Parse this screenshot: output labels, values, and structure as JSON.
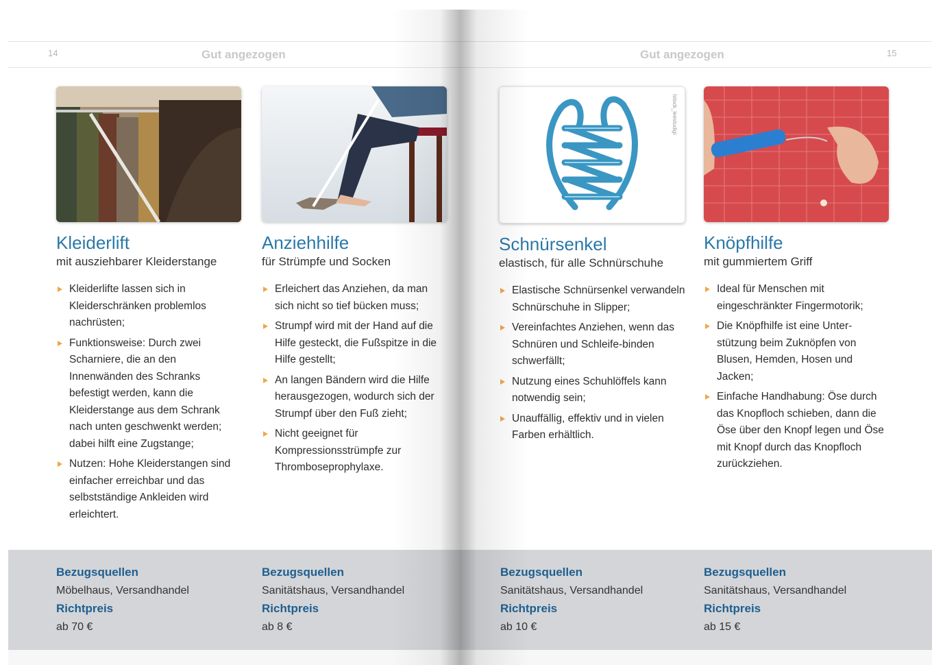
{
  "pages": {
    "left": {
      "number": "14",
      "running_head": "Gut angezogen"
    },
    "right": {
      "number": "15",
      "running_head": "Gut angezogen"
    }
  },
  "products": [
    {
      "title": "Kleiderlift",
      "subtitle": "mit ausziehbarer Kleiderstange",
      "bullets": [
        "Kleiderlifte lassen sich in Kleiderschränken problemlos nachrüsten;",
        "Funktionsweise: Durch zwei Scharniere, die an den Innenwänden des Schranks befestigt werden, kann die Kleiderstange aus dem Schrank nach unten geschwenkt werden; dabei hilft eine Zugstange;",
        "Nutzen: Hohe Kleiderstangen sind einfacher erreichbar und das selbstständige Ankleiden wird erleichtert."
      ],
      "sources_label": "Bezugsquellen",
      "sources": "Möbelhaus, Versandhandel",
      "price_label": "Richtpreis",
      "price": "ab 70 €"
    },
    {
      "title": "Anziehhilfe",
      "subtitle": "für Strümpfe und Socken",
      "bullets": [
        "Erleichert das Anziehen, da man sich nicht so tief bücken muss;",
        "Strumpf wird mit der Hand auf die Hilfe gesteckt, die Fußspitze in die Hilfe gestellt;",
        "An langen Bändern wird die Hilfe herausgezogen, wodurch sich der Strumpf über den Fuß zieht;",
        "Nicht geeignet für Kompressionsstrümpfe zur Thromboseprophylaxe."
      ],
      "sources_label": "Bezugsquellen",
      "sources": "Sanitätshaus, Versandhandel",
      "price_label": "Richtpreis",
      "price": "ab 8 €"
    },
    {
      "title": "Schnürsenkel",
      "subtitle": "elastisch, für alle Schnürschuhe",
      "photo_credit": "Istock_leestudigi",
      "bullets": [
        "Elastische Schnürsenkel verwandeln Schnürschuhe in Slipper;",
        "Vereinfachtes Anziehen, wenn das Schnüren und Schleife-binden schwerfällt;",
        "Nutzung eines Schuhlöffels kann notwendig sein;",
        "Unauffällig, effektiv und in vielen Farben erhältlich."
      ],
      "sources_label": "Bezugsquellen",
      "sources": "Sanitätshaus, Versandhandel",
      "price_label": "Richtpreis",
      "price": "ab 10 €"
    },
    {
      "title": "Knöpfhilfe",
      "subtitle": "mit gummiertem Griff",
      "bullets": [
        "Ideal für Menschen mit eingeschränkter Fingermotorik;",
        "Die Knöpfhilfe ist eine Unter-stützung beim Zuknöpfen von Blusen, Hemden, Hosen und Jacken;",
        "Einfache Handhabung: Öse durch das Knopfloch schieben, dann die Öse über den Knopf legen und Öse mit Knopf durch das Knopfloch zurückziehen."
      ],
      "sources_label": "Bezugsquellen",
      "sources": "Sanitätshaus, Versandhandel",
      "price_label": "Richtpreis",
      "price": "ab 15 €"
    }
  ],
  "colors": {
    "title_blue": "#2a78a8",
    "label_blue": "#1f5e8f",
    "bullet_orange": "#f0a64a",
    "footer_gray": "#d3d5d8"
  }
}
